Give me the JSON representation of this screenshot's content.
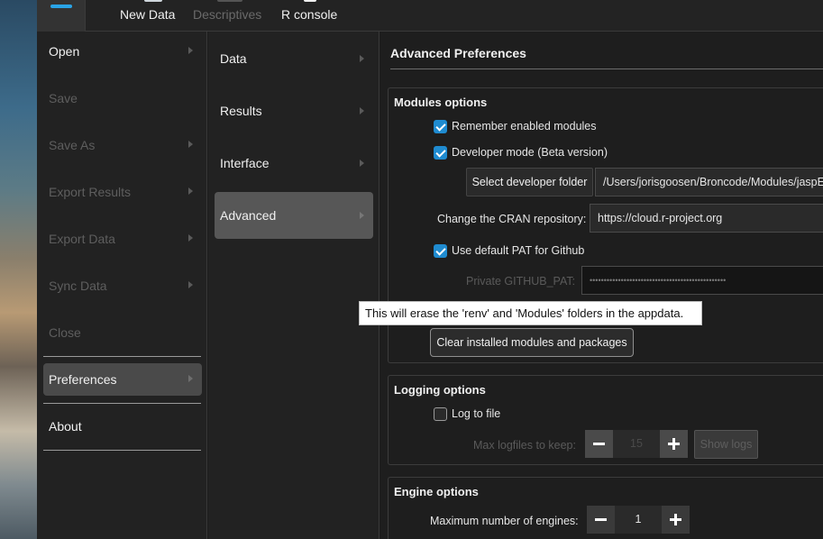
{
  "toolbar": {
    "items": [
      {
        "label": "New Data",
        "icon": "new-data-icon"
      },
      {
        "label": "Descriptives",
        "icon": "descriptives-icon",
        "disabled": true
      },
      {
        "label": "R console",
        "icon": "r-console-icon"
      }
    ]
  },
  "file_menu": {
    "items": [
      {
        "label": "Open"
      },
      {
        "label": "Save"
      },
      {
        "label": "Save As"
      },
      {
        "label": "Export Results"
      },
      {
        "label": "Export Data"
      },
      {
        "label": "Sync Data"
      },
      {
        "label": "Close"
      },
      {
        "label": "Preferences"
      },
      {
        "label": "About"
      }
    ]
  },
  "pref_menu": {
    "items": [
      {
        "label": "Data"
      },
      {
        "label": "Results"
      },
      {
        "label": "Interface"
      },
      {
        "label": "Advanced"
      }
    ]
  },
  "content": {
    "title": "Advanced Preferences",
    "modules": {
      "title": "Modules options",
      "remember_modules": "Remember enabled modules",
      "developer_mode": "Developer mode (Beta version)",
      "select_dev_folder": "Select developer folder",
      "dev_folder_path": "/Users/jorisgoosen/Broncode/Modules/jaspE",
      "cran_label": "Change the CRAN repository:",
      "cran_value": "https://cloud.r-project.org",
      "use_default_pat": "Use default PAT for Github",
      "pat_label": "Private GITHUB_PAT:",
      "pat_value": "••••••••••••••••••••••••••••••••••••••••••••••••",
      "clear_button": "Clear installed modules and packages"
    },
    "logging": {
      "title": "Logging options",
      "log_to_file": "Log to file",
      "max_logfiles_label": "Max logfiles to keep:",
      "max_logfiles_value": "15",
      "show_logs": "Show logs"
    },
    "engine": {
      "title": "Engine options",
      "max_engines_label": "Maximum number of engines:",
      "max_engines_value": "1"
    }
  },
  "tooltip": "This will erase the 'renv' and 'Modules' folders in the appdata.",
  "colors": {
    "accent": "#1f8bd0",
    "menu_accent": "#2aa4e6"
  }
}
